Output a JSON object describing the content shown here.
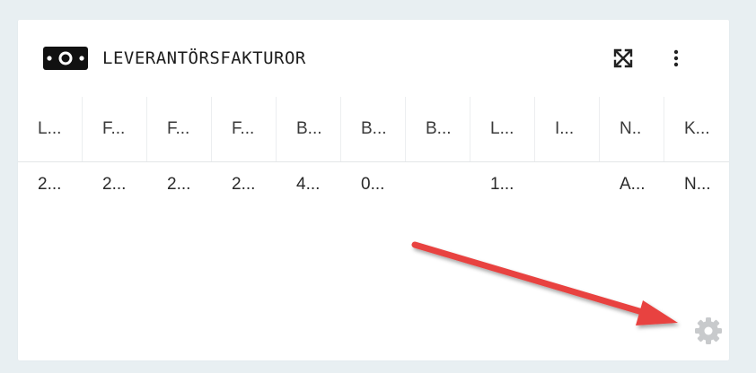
{
  "widget": {
    "title": "LEVERANTÖRSFAKTUROR",
    "icons": {
      "header": "money-bill-icon",
      "expand": "expand-icon",
      "menu": "vertical-dots-icon",
      "settings": "gear-icon"
    },
    "columns": [
      "L...",
      "F...",
      "F...",
      "F...",
      "B...",
      "B...",
      "B...",
      "L...",
      "I...",
      "N..",
      "K..."
    ],
    "rows": [
      [
        "2...",
        "2...",
        "2...",
        "2...",
        "4...",
        "0...",
        "",
        "1...",
        "",
        "A...",
        "N..."
      ]
    ]
  },
  "annotation": {
    "type": "red-arrow",
    "color": "#e8423f",
    "points_to": "settings-gear"
  },
  "colors": {
    "background": "#e8eff2",
    "card": "#ffffff",
    "gear": "#c8cacc"
  }
}
